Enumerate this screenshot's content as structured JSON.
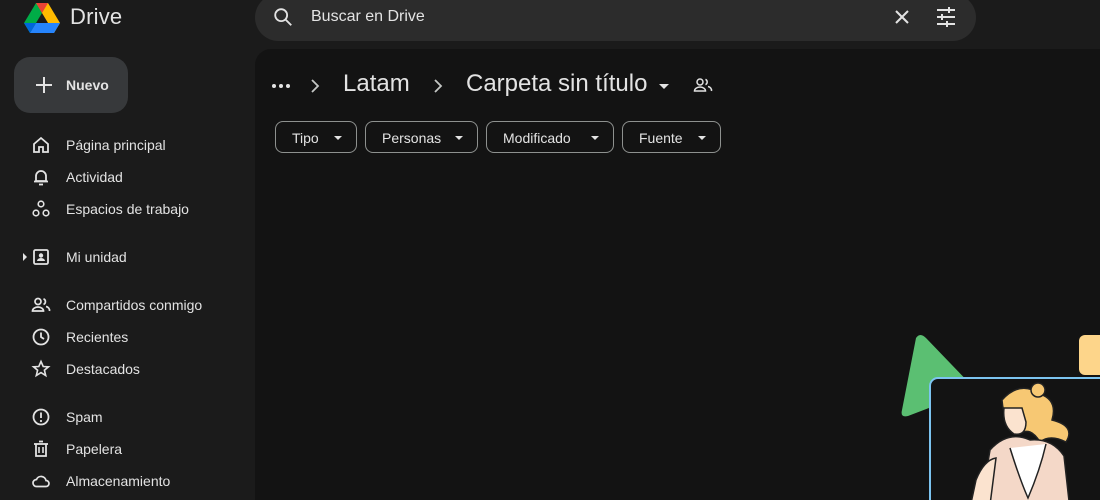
{
  "app": {
    "name": "Drive"
  },
  "search": {
    "text": "Buscar en Drive"
  },
  "sidebar": {
    "new_label": "Nuevo",
    "items": [
      {
        "label": "Página principal",
        "icon": "home-icon"
      },
      {
        "label": "Actividad",
        "icon": "bell-icon"
      },
      {
        "label": "Espacios de trabajo",
        "icon": "workspaces-icon"
      },
      {
        "label": "Mi unidad",
        "icon": "my-drive-icon"
      },
      {
        "label": "Compartidos conmigo",
        "icon": "people-icon"
      },
      {
        "label": "Recientes",
        "icon": "clock-icon"
      },
      {
        "label": "Destacados",
        "icon": "star-icon"
      },
      {
        "label": "Spam",
        "icon": "spam-icon"
      },
      {
        "label": "Papelera",
        "icon": "trash-icon"
      },
      {
        "label": "Almacenamiento",
        "icon": "cloud-icon"
      }
    ]
  },
  "breadcrumb": {
    "parent": "Latam",
    "current": "Carpeta sin título"
  },
  "filters": [
    {
      "label": "Tipo"
    },
    {
      "label": "Personas"
    },
    {
      "label": "Modificado"
    },
    {
      "label": "Fuente"
    }
  ],
  "colors": {
    "background": "#1b1b1b",
    "main_panel": "#131313",
    "search_bg": "#2c2c2c",
    "new_button_bg": "#37393b",
    "text": "#e3e3e3"
  }
}
